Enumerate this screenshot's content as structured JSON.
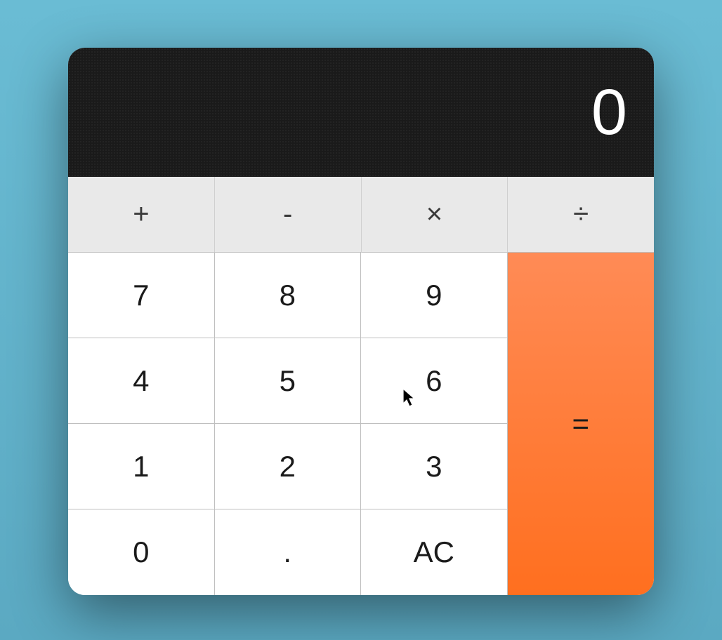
{
  "display": {
    "value": "0"
  },
  "operators": {
    "plus": "+",
    "minus": "-",
    "multiply": "×",
    "divide": "÷"
  },
  "keys": {
    "k7": "7",
    "k8": "8",
    "k9": "9",
    "k4": "4",
    "k5": "5",
    "k6": "6",
    "k1": "1",
    "k2": "2",
    "k3": "3",
    "k0": "0",
    "dot": ".",
    "ac": "AC"
  },
  "equals": "="
}
